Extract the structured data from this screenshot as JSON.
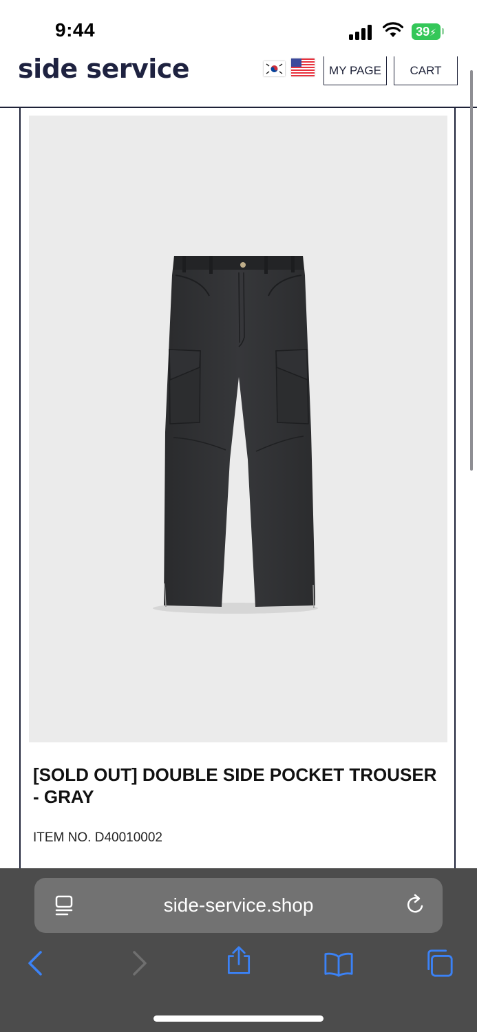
{
  "status_bar": {
    "time": "9:44",
    "battery": "39",
    "icons": [
      "signal-icon",
      "wifi-icon",
      "battery-icon"
    ]
  },
  "header": {
    "logo": "side service",
    "languages": [
      "korean-flag-icon",
      "us-flag-icon"
    ],
    "my_page_label": "MY PAGE",
    "cart_label": "CART"
  },
  "product": {
    "title": "[SOLD OUT] DOUBLE SIDE POCKET TROUSER - GRAY",
    "item_no": "ITEM NO. D40010002",
    "image": "trouser-photo"
  },
  "browser": {
    "url": "side-service.shop",
    "icons": [
      "reader-icon",
      "reload-icon",
      "back-icon",
      "forward-icon",
      "share-icon",
      "bookmarks-icon",
      "tabs-icon"
    ]
  },
  "colors": {
    "brand": "#1e2240",
    "accent_blue": "#3b82f6",
    "browser_bg": "#4c4c4c",
    "address_bg": "#727272",
    "battery_green": "#34c759",
    "image_bg": "#ebebeb"
  }
}
